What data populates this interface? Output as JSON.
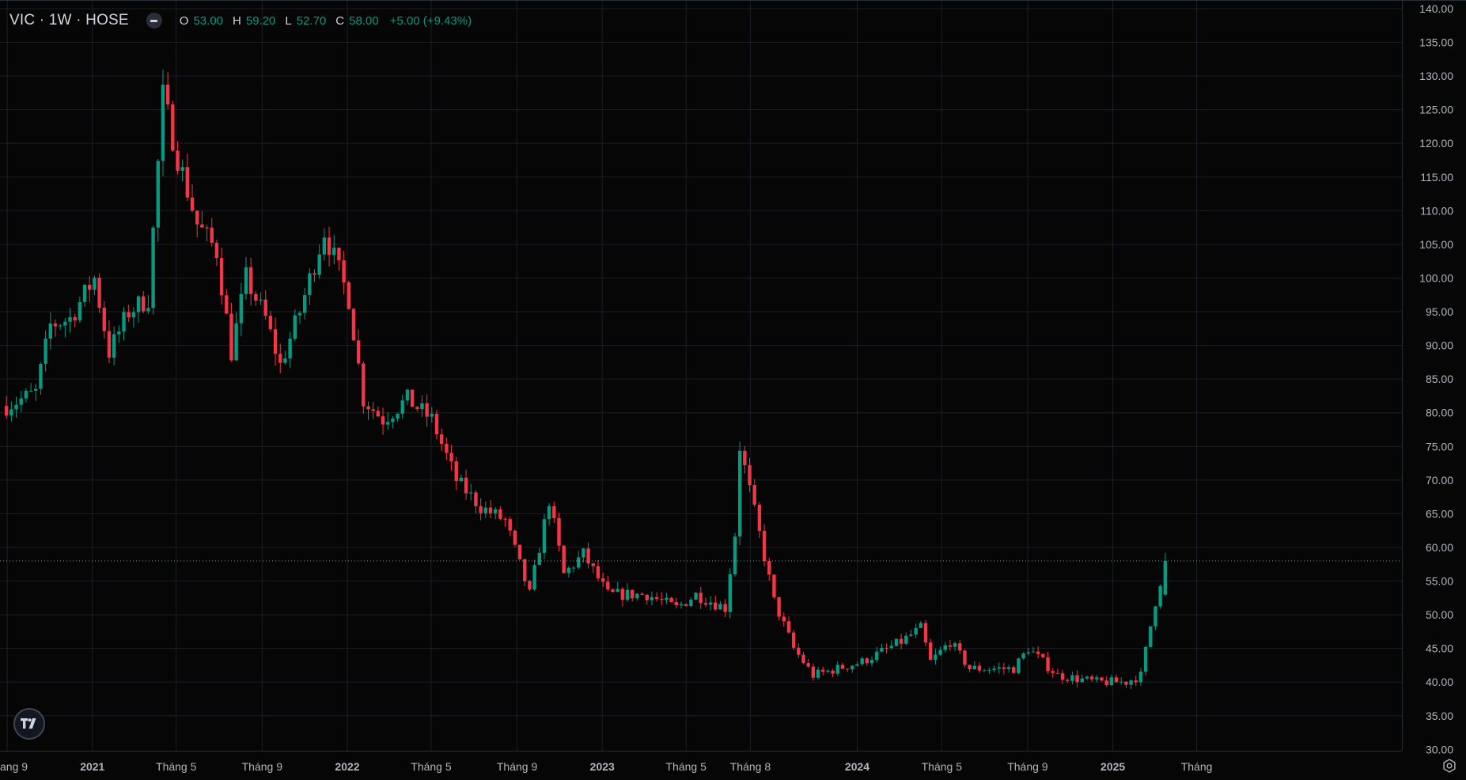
{
  "legend": {
    "symbol": "VIC · 1W · HOSE",
    "open_key": "O",
    "open": "53.00",
    "high_key": "H",
    "high": "59.20",
    "low_key": "L",
    "low": "52.70",
    "close_key": "C",
    "close": "58.00",
    "change": "+5.00 (+9.43%)"
  },
  "price_badge": "58.00",
  "colors": {
    "up": "#089981",
    "down": "#f23645",
    "background": "#060606",
    "grid": "#1c1f27",
    "axis_text": "#b2b5be"
  },
  "icons": {
    "logo": "tradingview-logo-icon",
    "indicator_toggle": "minus-icon",
    "settings": "gear-icon"
  },
  "chart_data": {
    "type": "candlestick",
    "title": "",
    "xlabel": "",
    "ylabel": "",
    "ylim": [
      30,
      140
    ],
    "grid": true,
    "y_ticks": [
      "140.00",
      "135.00",
      "130.00",
      "125.00",
      "120.00",
      "115.00",
      "110.00",
      "105.00",
      "100.00",
      "95.00",
      "90.00",
      "85.00",
      "80.00",
      "75.00",
      "70.00",
      "65.00",
      "60.00",
      "55.00",
      "50.00",
      "45.00",
      "40.00",
      "35.00",
      "30.00"
    ],
    "x_ticks": [
      {
        "label": "ang 9",
        "date": "2020-09"
      },
      {
        "label": "2021",
        "date": "2021-01"
      },
      {
        "label": "Tháng 5",
        "date": "2021-05"
      },
      {
        "label": "Tháng 9",
        "date": "2021-09"
      },
      {
        "label": "2022",
        "date": "2022-01"
      },
      {
        "label": "Tháng 5",
        "date": "2022-05"
      },
      {
        "label": "Tháng 9",
        "date": "2022-09"
      },
      {
        "label": "2023",
        "date": "2023-01"
      },
      {
        "label": "Tháng 5",
        "date": "2023-05"
      },
      {
        "label": "Tháng 8",
        "date": "2023-08"
      },
      {
        "label": "2024",
        "date": "2024-01"
      },
      {
        "label": "Tháng 5",
        "date": "2024-05"
      },
      {
        "label": "Tháng 9",
        "date": "2024-09"
      },
      {
        "label": "2025",
        "date": "2025-01"
      },
      {
        "label": "Tháng",
        "date": "2025-05"
      }
    ],
    "last_price": 58.0,
    "close_path": [
      {
        "date": "2020-08-31",
        "close": 81
      },
      {
        "date": "2020-10-12",
        "close": 83
      },
      {
        "date": "2020-11-02",
        "close": 93
      },
      {
        "date": "2020-11-30",
        "close": 94
      },
      {
        "date": "2021-01-04",
        "close": 100
      },
      {
        "date": "2021-01-25",
        "close": 89
      },
      {
        "date": "2021-02-22",
        "close": 95
      },
      {
        "date": "2021-03-22",
        "close": 97
      },
      {
        "date": "2021-04-12",
        "close": 127
      },
      {
        "date": "2021-05-03",
        "close": 118
      },
      {
        "date": "2021-05-31",
        "close": 108
      },
      {
        "date": "2021-06-28",
        "close": 104
      },
      {
        "date": "2021-07-19",
        "close": 89
      },
      {
        "date": "2021-08-09",
        "close": 100
      },
      {
        "date": "2021-09-06",
        "close": 94
      },
      {
        "date": "2021-09-27",
        "close": 87
      },
      {
        "date": "2021-10-25",
        "close": 95
      },
      {
        "date": "2021-11-29",
        "close": 107
      },
      {
        "date": "2022-01-03",
        "close": 97
      },
      {
        "date": "2022-01-24",
        "close": 82
      },
      {
        "date": "2022-02-21",
        "close": 79
      },
      {
        "date": "2022-03-28",
        "close": 82
      },
      {
        "date": "2022-05-02",
        "close": 79
      },
      {
        "date": "2022-06-06",
        "close": 70
      },
      {
        "date": "2022-07-11",
        "close": 66
      },
      {
        "date": "2022-08-15",
        "close": 64
      },
      {
        "date": "2022-09-19",
        "close": 53
      },
      {
        "date": "2022-10-17",
        "close": 67
      },
      {
        "date": "2022-11-07",
        "close": 56
      },
      {
        "date": "2022-12-05",
        "close": 59
      },
      {
        "date": "2023-01-09",
        "close": 53
      },
      {
        "date": "2023-03-06",
        "close": 53
      },
      {
        "date": "2023-04-17",
        "close": 51
      },
      {
        "date": "2023-05-15",
        "close": 53
      },
      {
        "date": "2023-06-26",
        "close": 51
      },
      {
        "date": "2023-07-10",
        "close": 62
      },
      {
        "date": "2023-07-17",
        "close": 75
      },
      {
        "date": "2023-08-14",
        "close": 62
      },
      {
        "date": "2023-09-04",
        "close": 52
      },
      {
        "date": "2023-10-02",
        "close": 45
      },
      {
        "date": "2023-10-30",
        "close": 41
      },
      {
        "date": "2024-01-08",
        "close": 43
      },
      {
        "date": "2024-03-04",
        "close": 46
      },
      {
        "date": "2024-04-01",
        "close": 48
      },
      {
        "date": "2024-04-15",
        "close": 43
      },
      {
        "date": "2024-05-13",
        "close": 46
      },
      {
        "date": "2024-06-10",
        "close": 42
      },
      {
        "date": "2024-08-12",
        "close": 42
      },
      {
        "date": "2024-09-02",
        "close": 45
      },
      {
        "date": "2024-10-14",
        "close": 41
      },
      {
        "date": "2024-12-09",
        "close": 40
      },
      {
        "date": "2025-01-20",
        "close": 40
      },
      {
        "date": "2025-02-10",
        "close": 41
      },
      {
        "date": "2025-03-03",
        "close": 52
      },
      {
        "date": "2025-03-17",
        "close": 58
      }
    ]
  }
}
